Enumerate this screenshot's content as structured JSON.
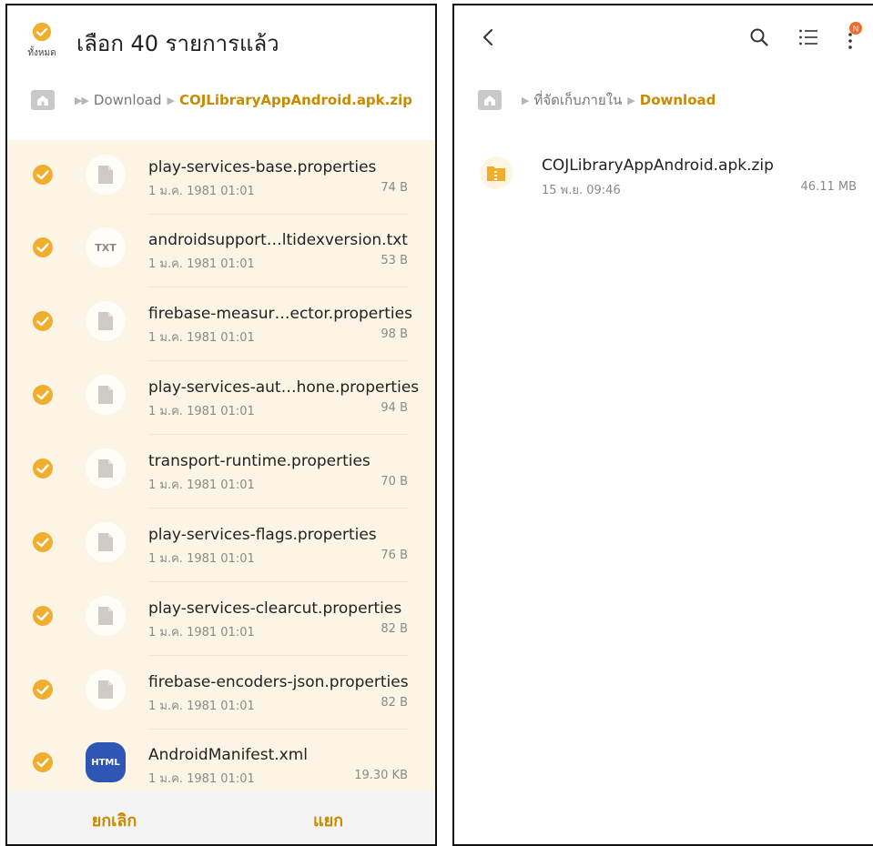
{
  "left_panel": {
    "select_all_label": "ทั้งหมด",
    "selection_title": "เลือก 40 รายการแล้ว",
    "breadcrumb": {
      "sep_double": "▶▶",
      "sep": "▶",
      "items": [
        "Download",
        "COJLibraryAppAndroid.apk.zip"
      ]
    },
    "files": [
      {
        "name": "play-services-base.properties",
        "date": "1 ม.ค. 1981 01:01",
        "size": "74 B",
        "icon": "file-icon"
      },
      {
        "name": "androidsupport…ltidexversion.txt",
        "date": "1 ม.ค. 1981 01:01",
        "size": "53 B",
        "icon": "txt-icon",
        "icon_text": "TXT"
      },
      {
        "name": "firebase-measur…ector.properties",
        "date": "1 ม.ค. 1981 01:01",
        "size": "98 B",
        "icon": "file-icon"
      },
      {
        "name": "play-services-aut…hone.properties",
        "date": "1 ม.ค. 1981 01:01",
        "size": "94 B",
        "icon": "file-icon"
      },
      {
        "name": "transport-runtime.properties",
        "date": "1 ม.ค. 1981 01:01",
        "size": "70 B",
        "icon": "file-icon"
      },
      {
        "name": "play-services-flags.properties",
        "date": "1 ม.ค. 1981 01:01",
        "size": "76 B",
        "icon": "file-icon"
      },
      {
        "name": "play-services-clearcut.properties",
        "date": "1 ม.ค. 1981 01:01",
        "size": "82 B",
        "icon": "file-icon"
      },
      {
        "name": "firebase-encoders-json.properties",
        "date": "1 ม.ค. 1981 01:01",
        "size": "82 B",
        "icon": "file-icon"
      },
      {
        "name": "AndroidManifest.xml",
        "date": "1 ม.ค. 1981 01:01",
        "size": "19.30 KB",
        "icon": "html-icon",
        "icon_text": "HTML"
      }
    ],
    "bottom_actions": {
      "cancel": "ยกเลิก",
      "extract": "แยก"
    }
  },
  "right_panel": {
    "notification_badge": "N",
    "breadcrumb": {
      "sep": "▶",
      "items": [
        "ที่จัดเก็บภายใน",
        "Download"
      ]
    },
    "item": {
      "name": "COJLibraryAppAndroid.apk.zip",
      "date": "15 พ.ย. 09:46",
      "size": "46.11 MB",
      "icon": "zip-folder-icon"
    }
  },
  "colors": {
    "accent": "#f0ad2e",
    "accent_text": "#c98a00",
    "selected_bg": "#fcf5e6",
    "badge": "#f06a2a"
  }
}
